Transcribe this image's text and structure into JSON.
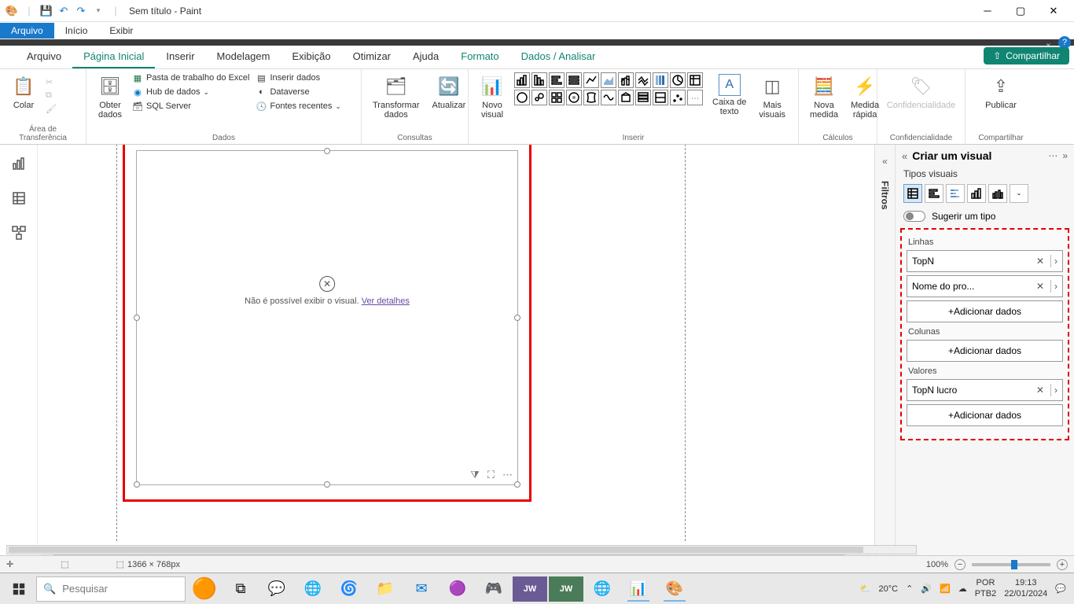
{
  "paint": {
    "title": "Sem título - Paint",
    "menu_file": "Arquivo",
    "menu_home": "Início",
    "menu_view": "Exibir"
  },
  "pbi_tabs": {
    "arquivo": "Arquivo",
    "pagina_inicial": "Página Inicial",
    "inserir": "Inserir",
    "modelagem": "Modelagem",
    "exibicao": "Exibição",
    "otimizar": "Otimizar",
    "ajuda": "Ajuda",
    "formato": "Formato",
    "dados_analisar": "Dados / Analisar",
    "compartilhar": "Compartilhar"
  },
  "ribbon": {
    "clipboard": {
      "colar": "Colar",
      "label": "Área de Transferência"
    },
    "dados": {
      "obter": "Obter\ndados",
      "excel": "Pasta de trabalho do Excel",
      "hub": "Hub de dados",
      "sql": "SQL Server",
      "inserir_dados": "Inserir dados",
      "dataverse": "Dataverse",
      "fontes": "Fontes recentes",
      "label": "Dados"
    },
    "consultas": {
      "transformar": "Transformar\ndados",
      "atualizar": "Atualizar",
      "label": "Consultas"
    },
    "inserir": {
      "novo_visual": "Novo\nvisual",
      "caixa_texto": "Caixa de\ntexto",
      "mais_visuais": "Mais\nvisuais",
      "label": "Inserir"
    },
    "calculos": {
      "nova_medida": "Nova\nmedida",
      "medida_rapida": "Medida\nrápida",
      "label": "Cálculos"
    },
    "confid": {
      "btn": "Confidencialidade",
      "label": "Confidencialidade"
    },
    "compart": {
      "btn": "Publicar",
      "label": "Compartilhar"
    }
  },
  "canvas": {
    "error_text": "Não é possível exibir o visual.",
    "error_link": "Ver detalhes"
  },
  "filters_label": "Filtros",
  "right": {
    "title": "Criar um visual",
    "tipos": "Tipos visuais",
    "sugerir": "Sugerir um tipo",
    "linhas": "Linhas",
    "colunas": "Colunas",
    "valores": "Valores",
    "field_topn": "TopN",
    "field_nome": "Nome do pro...",
    "field_topn_lucro": "TopN lucro",
    "add": "+Adicionar dados"
  },
  "status": {
    "dims": "1366 × 768px",
    "zoom": "100%"
  },
  "taskbar": {
    "search_placeholder": "Pesquisar",
    "temp": "20°C",
    "lang1": "POR",
    "lang2": "PTB2",
    "time": "19:13",
    "date": "22/01/2024"
  }
}
